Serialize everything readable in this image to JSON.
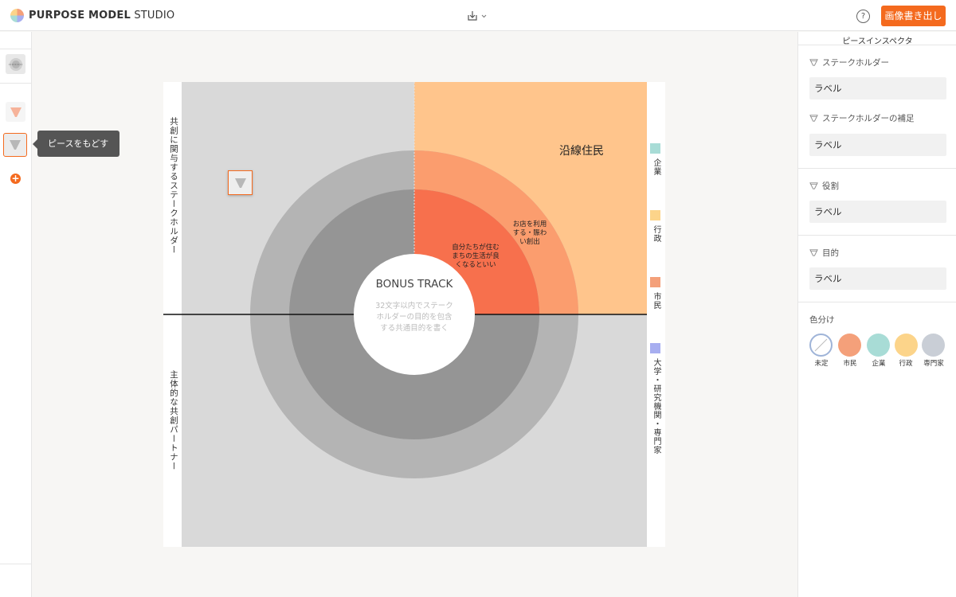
{
  "header": {
    "brand_bold": "PURPOSE MODEL",
    "brand_light": "STUDIO",
    "export_label": "画像書き出し",
    "help_label": "?"
  },
  "toolbar": {
    "tooltip": "ピースをもどす",
    "add_label": "+"
  },
  "canvas": {
    "left_top_label": "共創に関与するステークホルダー",
    "left_bottom_label": "主体的な共創パートナー",
    "center_title": "BONUS TRACK",
    "center_placeholder": [
      "32文字以内でステーク",
      "ホルダーの目的を包含",
      "する共通目的を書く"
    ],
    "quadrant_label": "沿線住民",
    "piece_text_outer": [
      "お店を利用",
      "する・賑わ",
      "い創出"
    ],
    "piece_text_inner": [
      "自分たちが住む",
      "まちの生活が良",
      "くなるといい"
    ]
  },
  "legend": [
    {
      "label": "企業",
      "color": "#a8dcd6"
    },
    {
      "label": "行政",
      "color": "#fcd48a"
    },
    {
      "label": "市民",
      "color": "#f4a07a"
    },
    {
      "label": "大学・研究機関・専門家",
      "color": "#a7aef0"
    }
  ],
  "inspector": {
    "title": "ピースインスペクタ",
    "fields": [
      {
        "label": "ステークホルダー",
        "value": "ラベル"
      },
      {
        "label": "ステークホルダーの補足",
        "value": "ラベル"
      },
      {
        "label": "役割",
        "value": "ラベル"
      },
      {
        "label": "目的",
        "value": "ラベル"
      }
    ],
    "color_label": "色分け",
    "swatches": [
      {
        "name": "未定",
        "color": "#ffffff"
      },
      {
        "name": "市民",
        "color": "#f4a07a"
      },
      {
        "name": "企業",
        "color": "#a8dcd6"
      },
      {
        "name": "行政",
        "color": "#fcd48a"
      },
      {
        "name": "専門家",
        "color": "#c9ced6"
      }
    ]
  },
  "colors": {
    "accent": "#f46a1e",
    "quadrant_bg": "#d9d9d9",
    "quadrant_highlight": "#ffc58c",
    "ring_outer": "#b4b4b4",
    "ring_outer_highlight": "#fb9d6e",
    "ring_inner": "#959595",
    "ring_inner_highlight": "#f7704d"
  }
}
